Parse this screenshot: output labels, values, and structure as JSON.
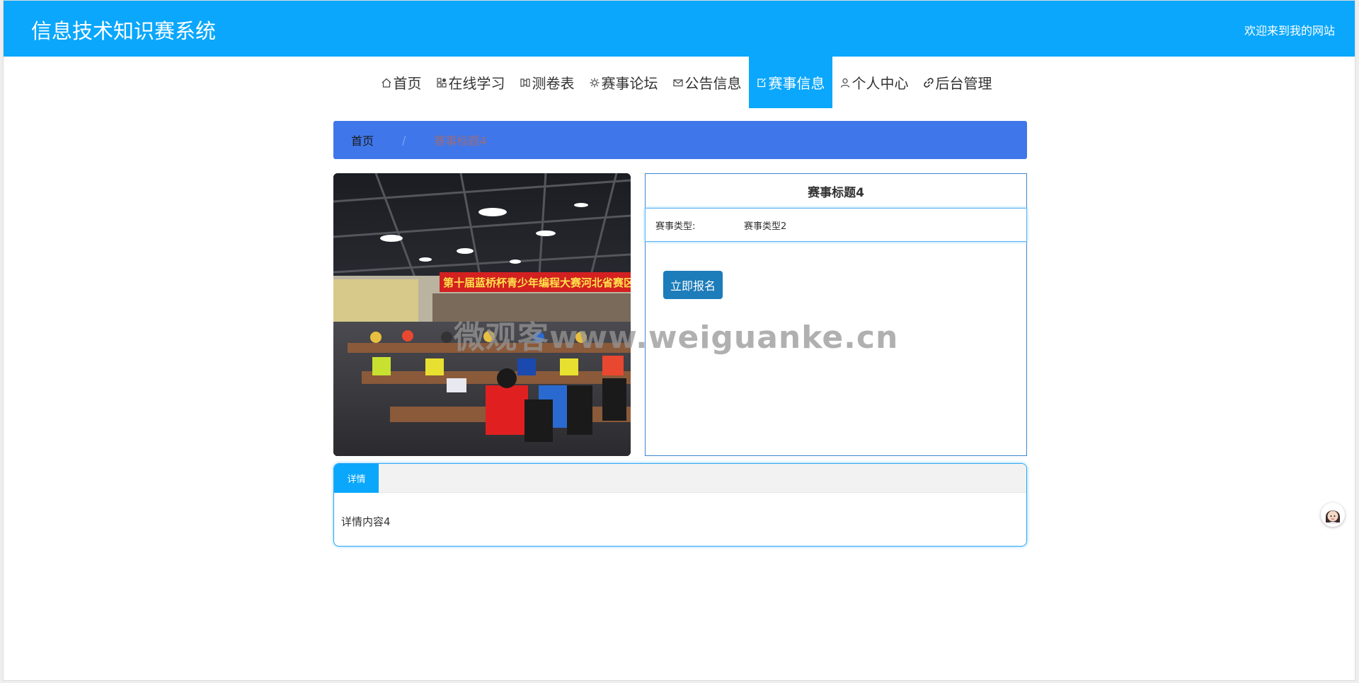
{
  "header": {
    "site_title": "信息技术知识赛系统",
    "welcome_text": "欢迎来到我的网站",
    "color": "#0aa7fc"
  },
  "nav": {
    "items": [
      {
        "label": "首页",
        "icon": "home-icon"
      },
      {
        "label": "在线学习",
        "icon": "grid-icon"
      },
      {
        "label": "测卷表",
        "icon": "book-icon"
      },
      {
        "label": "赛事论坛",
        "icon": "gear-icon"
      },
      {
        "label": "公告信息",
        "icon": "mail-icon"
      },
      {
        "label": "赛事信息",
        "icon": "edit-icon",
        "active": true
      },
      {
        "label": "个人中心",
        "icon": "user-icon"
      },
      {
        "label": "后台管理",
        "icon": "link-icon"
      }
    ]
  },
  "breadcrumb": {
    "home": "首页",
    "separator": "/",
    "current": "赛事标题4"
  },
  "event": {
    "title": "赛事标题4",
    "type_label": "赛事类型:",
    "type_value": "赛事类型2",
    "signup_label": "立即报名"
  },
  "details": {
    "tab_label": "详情",
    "content": "详情内容4"
  },
  "watermark": "微观客www.weiguanke.cn",
  "banner_text": "第十届蓝桥杯青少年编程大赛河北省赛区二考"
}
